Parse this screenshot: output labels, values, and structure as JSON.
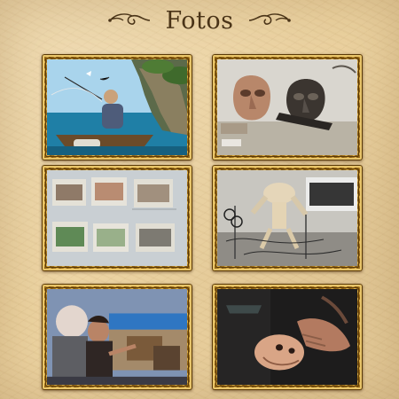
{
  "header": {
    "title": "Fotos",
    "left_ornament_icon": "flourish-left-icon",
    "right_ornament_icon": "flourish-right-icon"
  },
  "colors": {
    "background": "#ecd3a1",
    "title": "#4a3418",
    "frame_gold": "#c89a3a"
  },
  "gallery": {
    "photos": [
      {
        "subject": "fisherman-boat-photo"
      },
      {
        "subject": "clay-masks-photo"
      },
      {
        "subject": "storyboard-wall-photo"
      },
      {
        "subject": "puppet-workshop-photo"
      },
      {
        "subject": "animators-set-photo"
      },
      {
        "subject": "hand-puppet-head-photo"
      }
    ]
  }
}
